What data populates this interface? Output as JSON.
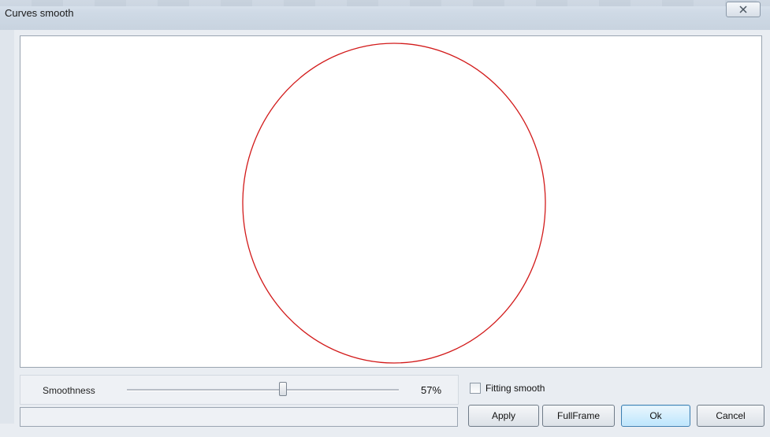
{
  "window": {
    "title": "Curves smooth"
  },
  "controls": {
    "smoothness_label": "Smoothness",
    "smoothness_value": 0.57,
    "smoothness_text": "57%",
    "fitting_smooth_label": "Fitting smooth",
    "fitting_smooth_checked": false
  },
  "buttons": {
    "apply": "Apply",
    "fullframe": "FullFrame",
    "ok": "Ok",
    "cancel": "Cancel"
  },
  "canvas": {
    "curve_color": "#d21a1a",
    "shape": "ellipse"
  },
  "icons": {
    "close": "close-icon"
  }
}
